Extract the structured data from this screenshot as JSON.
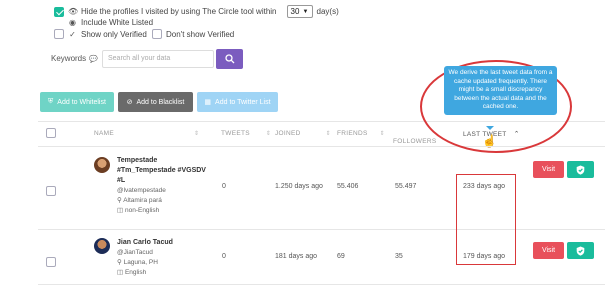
{
  "filters": {
    "hide_profiles": {
      "label_before": "Hide the profiles I visited by using The Circle tool within",
      "days_value": "30",
      "unit": "day(s)",
      "checked": true
    },
    "include_white_listed": {
      "label": "Include White Listed"
    },
    "show_only_verified": {
      "label": "Show only Verified"
    },
    "dont_show_verified": {
      "label": "Don't show Verified"
    }
  },
  "keywords": {
    "label": "Keywords",
    "placeholder": "Search all your data"
  },
  "actions": {
    "whitelist": "Add to Whitelist",
    "blacklist": "Add to Blacklist",
    "twitter_list": "Add to Twitter List"
  },
  "table": {
    "columns": {
      "name": "NAME",
      "tweets": "TWEETS",
      "joined": "JOINED",
      "friends": "FRIENDS",
      "followers": "FOLLOWERS",
      "last_tweet": "LAST TWEET"
    },
    "rows": [
      {
        "name_line1": "Tempestade",
        "name_line2": "#Tm_Tempestade #VGSDV",
        "name_line3": "#L",
        "handle": "@lvatempestade",
        "location": "Altamira pará",
        "language": "non-English",
        "tweets": "0",
        "joined": "1.250 days ago",
        "friends": "55.406",
        "followers": "55.497",
        "last_tweet": "233 days ago",
        "visit": "Visit"
      },
      {
        "name_line1": "Jian Carlo Tacud",
        "handle": "@JianTacud",
        "location": "Laguna, PH",
        "language": "English",
        "tweets": "0",
        "joined": "181 days ago",
        "friends": "69",
        "followers": "35",
        "last_tweet": "179 days ago",
        "visit": "Visit"
      }
    ]
  },
  "tooltip": {
    "text": "We derive the last tweet data from a cache updated frequently. There might be a small discrepancy between the actual data and the cached one."
  },
  "colors": {
    "accent": "#1abc9c",
    "purple": "#7b5cbf",
    "visit_red": "#e8505b",
    "annotation_red": "#d9383a",
    "tooltip_blue": "#3fa7e0"
  }
}
